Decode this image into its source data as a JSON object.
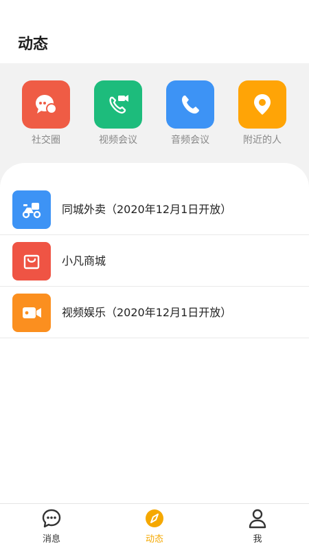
{
  "header": {
    "title": "动态"
  },
  "quick_actions": [
    {
      "label": "社交圈",
      "icon": "chat-bubble-icon",
      "color": "#ef5c45"
    },
    {
      "label": "视频会议",
      "icon": "video-call-icon",
      "color": "#1dbc7c"
    },
    {
      "label": "音频会议",
      "icon": "phone-icon",
      "color": "#3d93f5"
    },
    {
      "label": "附近的人",
      "icon": "location-pin-icon",
      "color": "#ffa406"
    }
  ],
  "list": [
    {
      "label": "同城外卖（2020年12月1日开放）",
      "icon": "scooter-icon",
      "color": "#3d93f5"
    },
    {
      "label": "小凡商城",
      "icon": "shopping-bag-icon",
      "color": "#ef5444"
    },
    {
      "label": "视频娱乐（2020年12月1日开放）",
      "icon": "video-camera-icon",
      "color": "#fb8f1f"
    }
  ],
  "tabs": [
    {
      "label": "消息",
      "icon": "message-icon",
      "active": false
    },
    {
      "label": "动态",
      "icon": "compass-icon",
      "active": true
    },
    {
      "label": "我",
      "icon": "person-icon",
      "active": false
    }
  ],
  "colors": {
    "accent": "#f5a800",
    "panel_bg": "#f2f2f2"
  }
}
